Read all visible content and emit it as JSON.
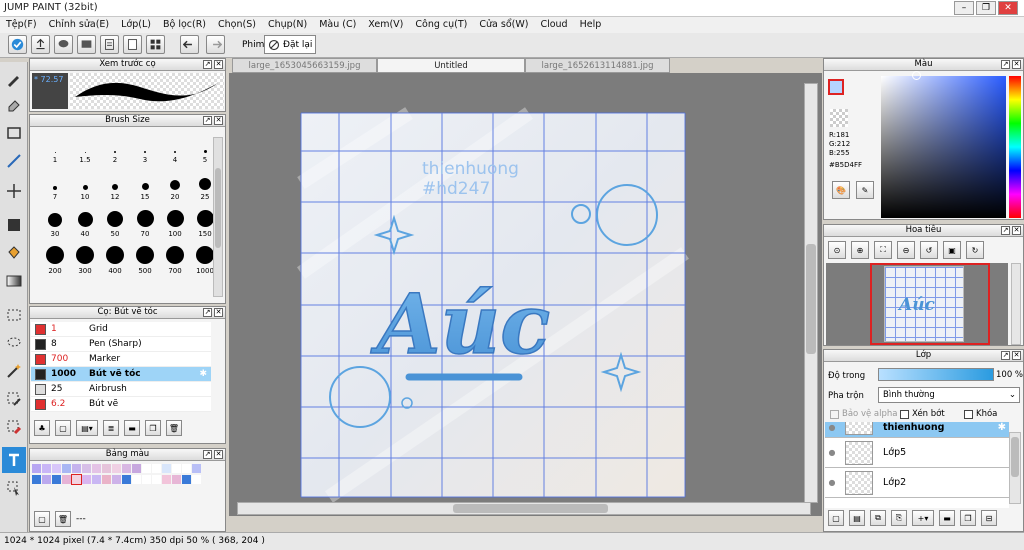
{
  "app": {
    "title": "JUMP PAINT (32bit)"
  },
  "menu": [
    "Tệp(F)",
    "Chỉnh sửa(E)",
    "Lớp(L)",
    "Bộ lọc(R)",
    "Chọn(S)",
    "Chụp(N)",
    "Màu (C)",
    "Xem(V)",
    "Công cụ(T)",
    "Cửa sổ(W)",
    "Cloud",
    "Help"
  ],
  "toolbar": {
    "film_label": "Phim",
    "reset_label": "Đặt lại"
  },
  "preview": {
    "title": "Xem trước cọ",
    "value": "* 72.57"
  },
  "brush_size": {
    "title": "Brush Size",
    "sizes": [
      "1",
      "1.5",
      "2",
      "3",
      "4",
      "5",
      "7",
      "10",
      "12",
      "15",
      "20",
      "25",
      "30",
      "40",
      "50",
      "70",
      "100",
      "150",
      "200",
      "300",
      "400",
      "500",
      "700",
      "1000"
    ]
  },
  "brush_list": {
    "title": "Cọ: Bút vẽ tóc",
    "items": [
      {
        "size": "1",
        "name": "Grid",
        "color": "#e03030"
      },
      {
        "size": "8",
        "name": "Pen (Sharp)",
        "color": "#222222"
      },
      {
        "size": "700",
        "name": "Marker",
        "color": "#e03030"
      },
      {
        "size": "1000",
        "name": "Bút vẽ tóc",
        "color": "#222222"
      },
      {
        "size": "25",
        "name": "Airbrush",
        "color": "#dddddd"
      },
      {
        "size": "6.2",
        "name": "Bút vẽ",
        "color": "#e03030"
      }
    ]
  },
  "palette": {
    "title": "Bảng màu",
    "footer": "---"
  },
  "tabs": [
    {
      "label": "large_1653045663159.jpg"
    },
    {
      "label": "Untitled"
    },
    {
      "label": "large_1652613114881.jpg"
    }
  ],
  "artwork": {
    "watermark_line1": "thienhuong",
    "watermark_line2": "#hd247",
    "main_word": "Aúc"
  },
  "color_panel": {
    "title": "Màu",
    "r": "R:181",
    "g": "G:212",
    "b": "B:255",
    "hex": "#B5D4FF",
    "current": "#B5D4FF"
  },
  "navigator": {
    "title": "Hoa tiêu"
  },
  "layers": {
    "title": "Lớp",
    "opacity_label": "Độ trong",
    "opacity_value": "100 %",
    "blend_label": "Pha trộn",
    "blend_value": "Bình thường",
    "protect_alpha": "Bảo vệ alpha",
    "clip": "Xén bớt",
    "lock": "Khóa",
    "items": [
      {
        "name": "thienhuong"
      },
      {
        "name": "Lớp5"
      },
      {
        "name": "Lớp2"
      }
    ]
  },
  "status": {
    "text": "1024 * 1024 pixel   (7.4 * 7.4cm)   350 dpi   50 %   ( 368, 204 )"
  }
}
